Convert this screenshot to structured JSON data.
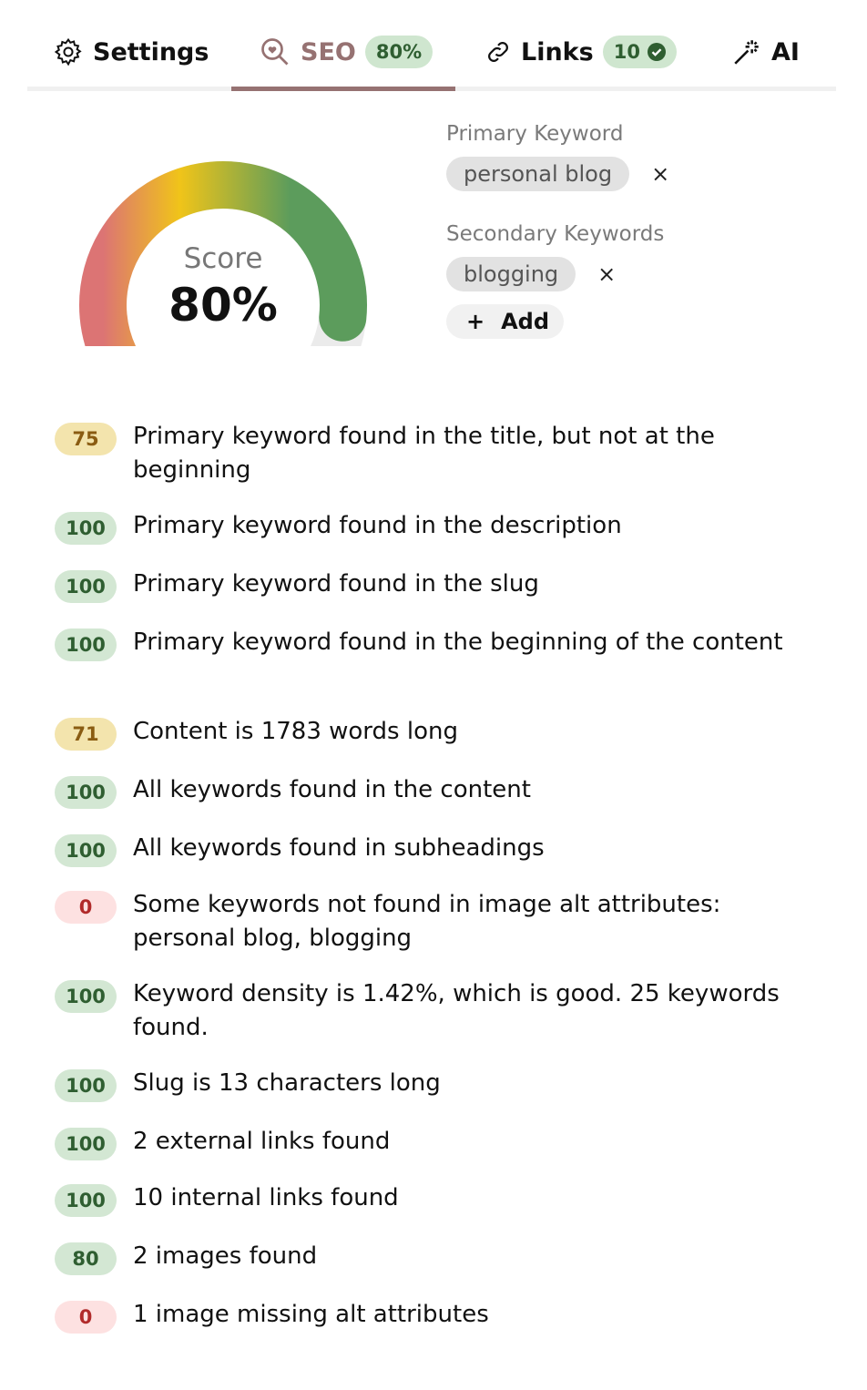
{
  "tabs": [
    {
      "label": "Settings",
      "icon": "gear-icon"
    },
    {
      "label": "SEO",
      "icon": "heart-search-icon",
      "badge": "80%",
      "active": true
    },
    {
      "label": "Links",
      "icon": "link-icon",
      "badge": "10"
    },
    {
      "label": "AI",
      "icon": "magic-wand-icon"
    }
  ],
  "gauge": {
    "label": "Score",
    "value_text": "80%",
    "value": 80,
    "max": 100
  },
  "keywords": {
    "primary_label": "Primary Keyword",
    "primary": "personal blog",
    "secondary_label": "Secondary Keywords",
    "secondary": [
      "blogging"
    ],
    "remove_glyph": "×",
    "add_label": "Add",
    "add_glyph": "+"
  },
  "checks": [
    {
      "score": "75",
      "status": "yellow",
      "text": "Primary keyword found in the title, but not at the beginning"
    },
    {
      "score": "100",
      "status": "green",
      "text": "Primary keyword found in the description"
    },
    {
      "score": "100",
      "status": "green",
      "text": "Primary keyword found in the slug"
    },
    {
      "score": "100",
      "status": "green",
      "text": "Primary keyword found in the beginning of the content"
    },
    {
      "score": "71",
      "status": "yellow",
      "text": "Content is 1783 words long"
    },
    {
      "score": "100",
      "status": "green",
      "text": "All keywords found in the content"
    },
    {
      "score": "100",
      "status": "green",
      "text": "All keywords found in subheadings"
    },
    {
      "score": "0",
      "status": "red",
      "text": "Some keywords not found in image alt attributes: personal blog, blogging"
    },
    {
      "score": "100",
      "status": "green",
      "text": "Keyword density is 1.42%, which is good. 25 keywords found."
    },
    {
      "score": "100",
      "status": "green",
      "text": "Slug is 13 characters long"
    },
    {
      "score": "100",
      "status": "green",
      "text": "2 external links found"
    },
    {
      "score": "100",
      "status": "green",
      "text": "10 internal links found"
    },
    {
      "score": "80",
      "status": "green",
      "text": "2 images found"
    },
    {
      "score": "0",
      "status": "red",
      "text": "1 image missing alt attributes"
    }
  ]
}
